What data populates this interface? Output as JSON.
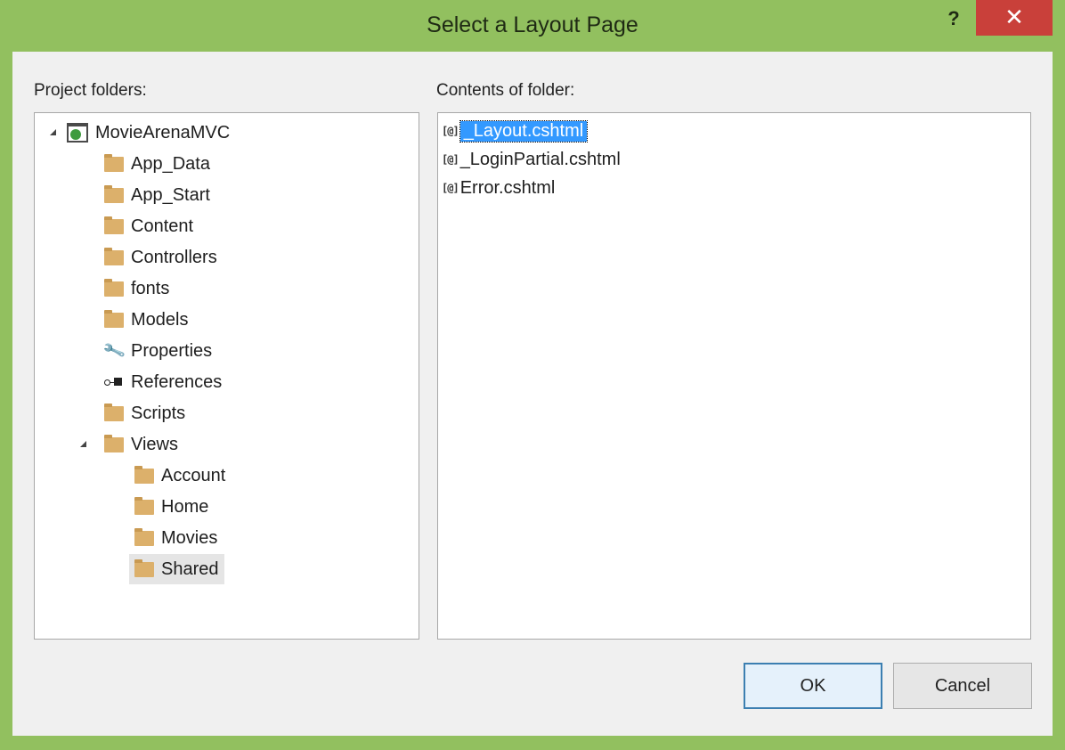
{
  "window": {
    "title": "Select a Layout Page",
    "help_label": "?",
    "close_label": "✕"
  },
  "left_panel": {
    "label": "Project folders:",
    "tree": [
      {
        "label": "MovieArenaMVC",
        "icon": "project-icon",
        "expanded": true
      },
      {
        "label": "App_Data",
        "icon": "folder-icon"
      },
      {
        "label": "App_Start",
        "icon": "folder-icon"
      },
      {
        "label": "Content",
        "icon": "folder-icon"
      },
      {
        "label": "Controllers",
        "icon": "folder-icon"
      },
      {
        "label": "fonts",
        "icon": "folder-icon"
      },
      {
        "label": "Models",
        "icon": "folder-icon"
      },
      {
        "label": "Properties",
        "icon": "wrench-icon"
      },
      {
        "label": "References",
        "icon": "references-icon"
      },
      {
        "label": "Scripts",
        "icon": "folder-icon"
      },
      {
        "label": "Views",
        "icon": "folder-icon",
        "expanded": true
      },
      {
        "label": "Account",
        "icon": "folder-icon"
      },
      {
        "label": "Home",
        "icon": "folder-icon"
      },
      {
        "label": "Movies",
        "icon": "folder-icon"
      },
      {
        "label": "Shared",
        "icon": "folder-icon",
        "selected": true
      }
    ]
  },
  "right_panel": {
    "label": "Contents of folder:",
    "files": [
      {
        "label": "_Layout.cshtml",
        "icon": "cshtml-icon",
        "selected": true
      },
      {
        "label": "_LoginPartial.cshtml",
        "icon": "cshtml-icon"
      },
      {
        "label": "Error.cshtml",
        "icon": "cshtml-icon"
      }
    ],
    "file_icon_glyph": "[@]"
  },
  "buttons": {
    "ok": "OK",
    "cancel": "Cancel"
  },
  "colors": {
    "frame": "#92c05f",
    "close": "#c9403a",
    "selection": "#3399ff",
    "folder": "#dcb06b"
  }
}
